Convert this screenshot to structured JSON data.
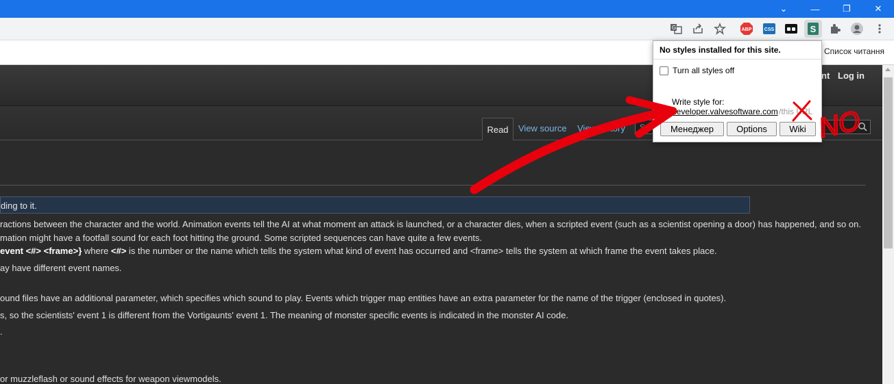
{
  "browser": {
    "reading_list_label": "Список читання",
    "toolbar_icons": [
      "translate-icon",
      "share-icon",
      "star-icon",
      "abp-icon",
      "css-icon",
      "stylus-icon",
      "puzzle-icon",
      "profile-icon",
      "more-icon"
    ],
    "abp_label": "ABP",
    "css_label": "CSS",
    "stylus_label": "S"
  },
  "site": {
    "personal_links": [
      "nt",
      "Log in"
    ],
    "tabs": {
      "read": "Read",
      "view_source": "View source",
      "view_history": "View history"
    },
    "search_placeholder": "Search"
  },
  "content": {
    "notice": "ding to it.",
    "lines": [
      "ractions between the character and the world. Animation events tell the AI at what moment an attack is launched, or a character dies, when a scripted event (such as a scientist opening a door) has happened, and so on.",
      "mation might have a footfall sound for each foot hitting the ground. Some scripted sequences can have quite a few events.",
      "ay have different event names.",
      "ound files have an additional parameter, which specifies which sound to play. Events which trigger map entities have an extra parameter for the name of the trigger (enclosed in quotes).",
      "s, so the scientists' event 1 is different from the Vortigaunts' event 1. The meaning of monster specific events is indicated in the monster AI code.",
      ".",
      "or muzzleflash or sound effects for weapon viewmodels."
    ],
    "event_line": {
      "bold_part": "event <#> <frame>}",
      "mid_part": " where ",
      "hash": "<#>",
      "rest": " is the number or the name which tells the system what kind of event has occurred and <frame> tells the system at which frame the event takes place."
    }
  },
  "popup": {
    "header": "No styles installed for this site.",
    "checkbox_label": "Turn all styles off",
    "write_label": "Write style for:",
    "domain_link": "developer.valvesoftware.com",
    "url_faded": "/this URL",
    "buttons": {
      "manager": "Менеджер",
      "options": "Options",
      "wiki": "Wiki"
    }
  },
  "annotation": {
    "text": "NO",
    "color": "#e8000d"
  }
}
